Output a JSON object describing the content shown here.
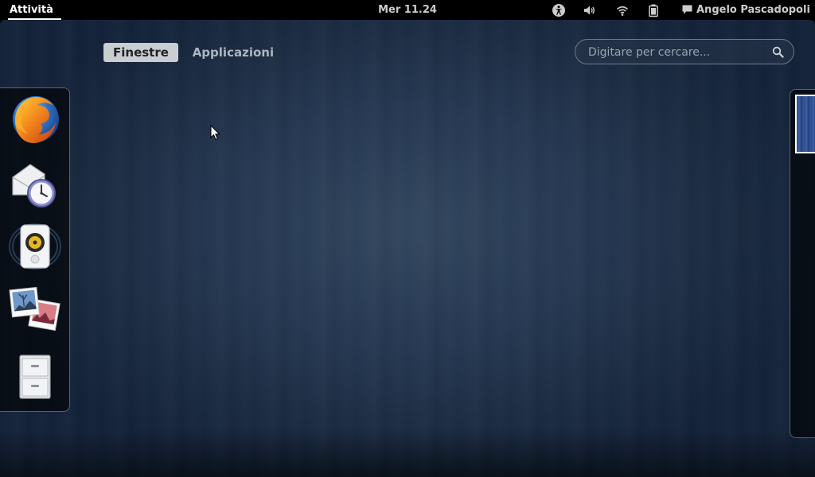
{
  "topbar": {
    "activities_label": "Attività",
    "clock": "Mer 11.24",
    "user_name": "Angelo Pascadopoli",
    "tray_icons": [
      "accessibility-icon",
      "volume-icon",
      "wifi-icon",
      "battery-icon",
      "chat-icon"
    ]
  },
  "overview": {
    "tabs": [
      {
        "label": "Finestre",
        "active": true
      },
      {
        "label": "Applicazioni",
        "active": false
      }
    ],
    "search": {
      "placeholder": "Digitare per cercare...",
      "value": ""
    }
  },
  "dash": {
    "apps": [
      "firefox-icon",
      "evolution-mail-calendar-icon",
      "rhythmbox-speaker-icon",
      "image-viewer-photos-icon",
      "file-cabinet-icon"
    ]
  },
  "colors": {
    "topbar_bg": "#000000",
    "active_tab_bg": "#c9ced3",
    "overview_bg": "#263852"
  }
}
